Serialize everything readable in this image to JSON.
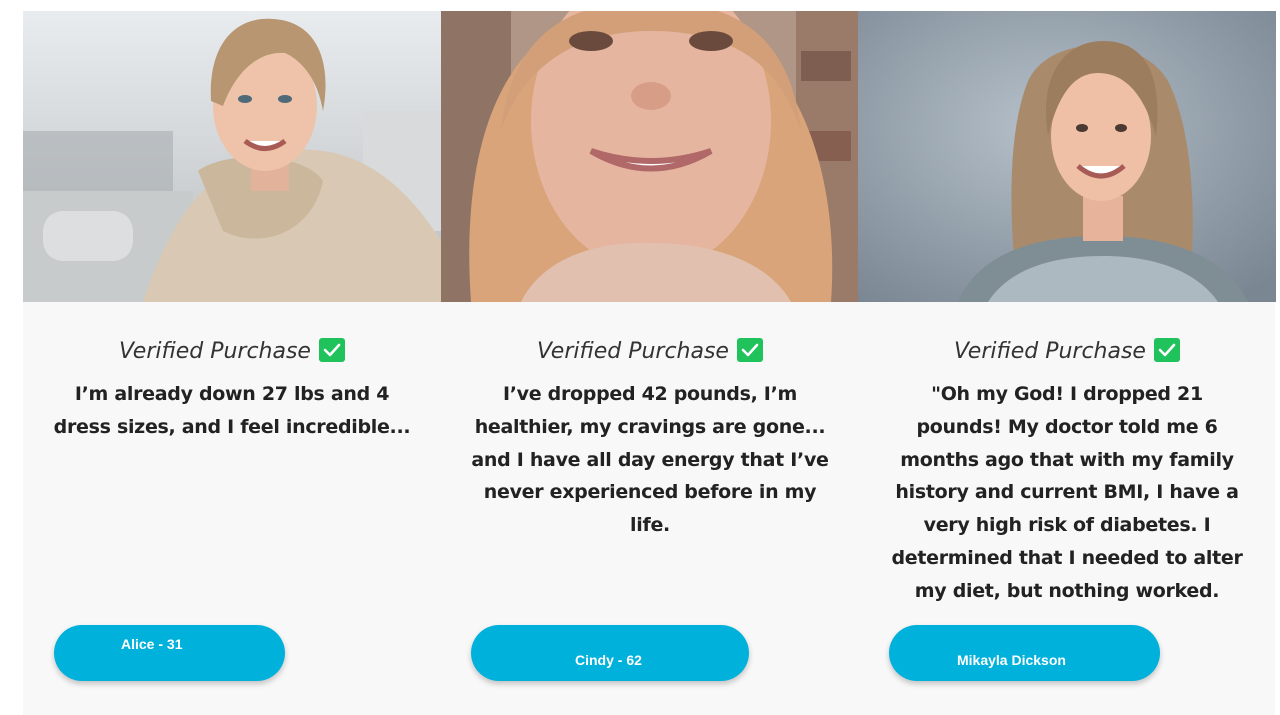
{
  "testimonials": [
    {
      "verified_label": "Verified Purchase",
      "quote": "I’m already down 27 lbs and 4 dress sizes, and I feel incredible...",
      "name": "Alice - 31"
    },
    {
      "verified_label": "Verified Purchase",
      "quote": "I’ve dropped 42 pounds, I’m healthier, my cravings are gone... and I have all day energy that I’ve never experienced before in my life.",
      "name": "Cindy - 62"
    },
    {
      "verified_label": "Verified Purchase",
      "quote": "\"Oh my God! I dropped 21 pounds! My doctor told me 6 months ago that with my family history and current BMI, I have a very high risk of diabetes. I determined that I needed to alter my diet, but nothing worked.",
      "name": "Mikayla Dickson"
    }
  ],
  "colors": {
    "button": "#00b1dc",
    "check": "#1fc25b",
    "panel": "#f8f8f8",
    "text": "#222222"
  },
  "icons": {
    "verified": "check-square-icon"
  }
}
